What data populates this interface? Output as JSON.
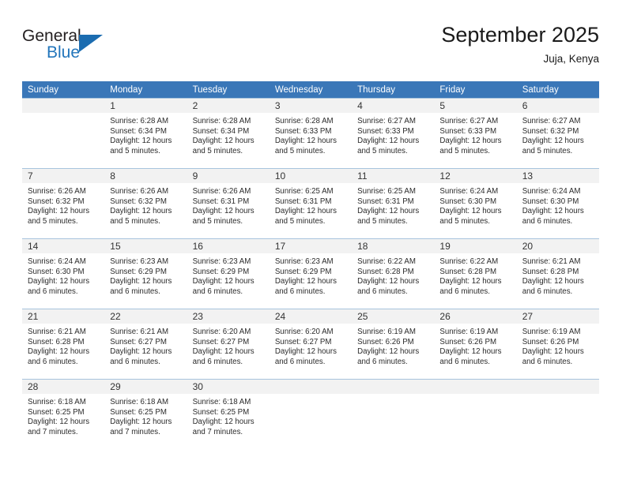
{
  "brand": {
    "word_general": "General",
    "word_blue": "Blue",
    "accent_color": "#1b6cb0"
  },
  "header": {
    "title": "September 2025",
    "subtitle": "Juja, Kenya"
  },
  "theme": {
    "header_row_bg": "#3a77b8",
    "daynum_band_bg": "#f2f2f2",
    "grid_line": "#a8c4dd"
  },
  "weekday_headers": [
    "Sunday",
    "Monday",
    "Tuesday",
    "Wednesday",
    "Thursday",
    "Friday",
    "Saturday"
  ],
  "weeks": [
    [
      {
        "day": "",
        "lines": []
      },
      {
        "day": "1",
        "lines": [
          "Sunrise: 6:28 AM",
          "Sunset: 6:34 PM",
          "Daylight: 12 hours",
          "and 5 minutes."
        ]
      },
      {
        "day": "2",
        "lines": [
          "Sunrise: 6:28 AM",
          "Sunset: 6:34 PM",
          "Daylight: 12 hours",
          "and 5 minutes."
        ]
      },
      {
        "day": "3",
        "lines": [
          "Sunrise: 6:28 AM",
          "Sunset: 6:33 PM",
          "Daylight: 12 hours",
          "and 5 minutes."
        ]
      },
      {
        "day": "4",
        "lines": [
          "Sunrise: 6:27 AM",
          "Sunset: 6:33 PM",
          "Daylight: 12 hours",
          "and 5 minutes."
        ]
      },
      {
        "day": "5",
        "lines": [
          "Sunrise: 6:27 AM",
          "Sunset: 6:33 PM",
          "Daylight: 12 hours",
          "and 5 minutes."
        ]
      },
      {
        "day": "6",
        "lines": [
          "Sunrise: 6:27 AM",
          "Sunset: 6:32 PM",
          "Daylight: 12 hours",
          "and 5 minutes."
        ]
      }
    ],
    [
      {
        "day": "7",
        "lines": [
          "Sunrise: 6:26 AM",
          "Sunset: 6:32 PM",
          "Daylight: 12 hours",
          "and 5 minutes."
        ]
      },
      {
        "day": "8",
        "lines": [
          "Sunrise: 6:26 AM",
          "Sunset: 6:32 PM",
          "Daylight: 12 hours",
          "and 5 minutes."
        ]
      },
      {
        "day": "9",
        "lines": [
          "Sunrise: 6:26 AM",
          "Sunset: 6:31 PM",
          "Daylight: 12 hours",
          "and 5 minutes."
        ]
      },
      {
        "day": "10",
        "lines": [
          "Sunrise: 6:25 AM",
          "Sunset: 6:31 PM",
          "Daylight: 12 hours",
          "and 5 minutes."
        ]
      },
      {
        "day": "11",
        "lines": [
          "Sunrise: 6:25 AM",
          "Sunset: 6:31 PM",
          "Daylight: 12 hours",
          "and 5 minutes."
        ]
      },
      {
        "day": "12",
        "lines": [
          "Sunrise: 6:24 AM",
          "Sunset: 6:30 PM",
          "Daylight: 12 hours",
          "and 5 minutes."
        ]
      },
      {
        "day": "13",
        "lines": [
          "Sunrise: 6:24 AM",
          "Sunset: 6:30 PM",
          "Daylight: 12 hours",
          "and 6 minutes."
        ]
      }
    ],
    [
      {
        "day": "14",
        "lines": [
          "Sunrise: 6:24 AM",
          "Sunset: 6:30 PM",
          "Daylight: 12 hours",
          "and 6 minutes."
        ]
      },
      {
        "day": "15",
        "lines": [
          "Sunrise: 6:23 AM",
          "Sunset: 6:29 PM",
          "Daylight: 12 hours",
          "and 6 minutes."
        ]
      },
      {
        "day": "16",
        "lines": [
          "Sunrise: 6:23 AM",
          "Sunset: 6:29 PM",
          "Daylight: 12 hours",
          "and 6 minutes."
        ]
      },
      {
        "day": "17",
        "lines": [
          "Sunrise: 6:23 AM",
          "Sunset: 6:29 PM",
          "Daylight: 12 hours",
          "and 6 minutes."
        ]
      },
      {
        "day": "18",
        "lines": [
          "Sunrise: 6:22 AM",
          "Sunset: 6:28 PM",
          "Daylight: 12 hours",
          "and 6 minutes."
        ]
      },
      {
        "day": "19",
        "lines": [
          "Sunrise: 6:22 AM",
          "Sunset: 6:28 PM",
          "Daylight: 12 hours",
          "and 6 minutes."
        ]
      },
      {
        "day": "20",
        "lines": [
          "Sunrise: 6:21 AM",
          "Sunset: 6:28 PM",
          "Daylight: 12 hours",
          "and 6 minutes."
        ]
      }
    ],
    [
      {
        "day": "21",
        "lines": [
          "Sunrise: 6:21 AM",
          "Sunset: 6:28 PM",
          "Daylight: 12 hours",
          "and 6 minutes."
        ]
      },
      {
        "day": "22",
        "lines": [
          "Sunrise: 6:21 AM",
          "Sunset: 6:27 PM",
          "Daylight: 12 hours",
          "and 6 minutes."
        ]
      },
      {
        "day": "23",
        "lines": [
          "Sunrise: 6:20 AM",
          "Sunset: 6:27 PM",
          "Daylight: 12 hours",
          "and 6 minutes."
        ]
      },
      {
        "day": "24",
        "lines": [
          "Sunrise: 6:20 AM",
          "Sunset: 6:27 PM",
          "Daylight: 12 hours",
          "and 6 minutes."
        ]
      },
      {
        "day": "25",
        "lines": [
          "Sunrise: 6:19 AM",
          "Sunset: 6:26 PM",
          "Daylight: 12 hours",
          "and 6 minutes."
        ]
      },
      {
        "day": "26",
        "lines": [
          "Sunrise: 6:19 AM",
          "Sunset: 6:26 PM",
          "Daylight: 12 hours",
          "and 6 minutes."
        ]
      },
      {
        "day": "27",
        "lines": [
          "Sunrise: 6:19 AM",
          "Sunset: 6:26 PM",
          "Daylight: 12 hours",
          "and 6 minutes."
        ]
      }
    ],
    [
      {
        "day": "28",
        "lines": [
          "Sunrise: 6:18 AM",
          "Sunset: 6:25 PM",
          "Daylight: 12 hours",
          "and 7 minutes."
        ]
      },
      {
        "day": "29",
        "lines": [
          "Sunrise: 6:18 AM",
          "Sunset: 6:25 PM",
          "Daylight: 12 hours",
          "and 7 minutes."
        ]
      },
      {
        "day": "30",
        "lines": [
          "Sunrise: 6:18 AM",
          "Sunset: 6:25 PM",
          "Daylight: 12 hours",
          "and 7 minutes."
        ]
      },
      {
        "day": "",
        "lines": []
      },
      {
        "day": "",
        "lines": []
      },
      {
        "day": "",
        "lines": []
      },
      {
        "day": "",
        "lines": []
      }
    ]
  ]
}
